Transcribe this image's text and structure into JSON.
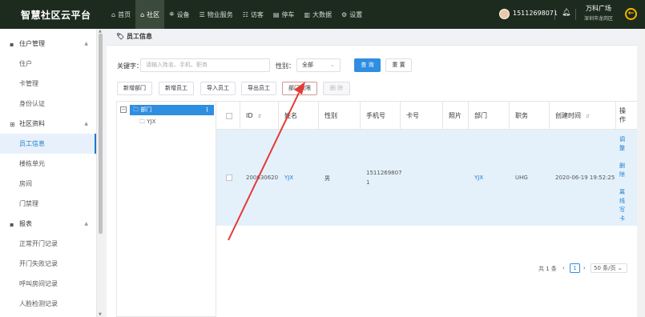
{
  "app": {
    "title": "智慧社区云平台"
  },
  "topnav": [
    {
      "icon": "⌂",
      "label": "首页"
    },
    {
      "icon": "⌂",
      "label": "社区"
    },
    {
      "icon": "⛯",
      "label": "设备"
    },
    {
      "icon": "☰",
      "label": "物业服务"
    },
    {
      "icon": "☷",
      "label": "访客"
    },
    {
      "icon": "▤",
      "label": "停车"
    },
    {
      "icon": "▥",
      "label": "大数据"
    },
    {
      "icon": "⚙",
      "label": "设置"
    }
  ],
  "user": {
    "phone": "15112698071",
    "site_name": "万科广场",
    "site_area": "深圳市龙岗区"
  },
  "sidebar": {
    "groups": [
      {
        "label": "住户管理",
        "items": [
          "住户",
          "卡管理",
          "身份认证"
        ]
      },
      {
        "label": "社区资料",
        "items": [
          "员工信息",
          "楼栋单元",
          "房间",
          "门禁理"
        ]
      },
      {
        "label": "报表",
        "items": [
          "正常开门记录",
          "开门失败记录",
          "呼叫房间记录",
          "人脸检测记录"
        ]
      }
    ]
  },
  "breadcrumb": "员工信息",
  "filters": {
    "keyword_label": "关键字：",
    "keyword_placeholder": "请输入姓名、手机、职务",
    "gender_label": "性别：",
    "gender_value": "全部",
    "search_label": "查 询",
    "reset_label": "重 置"
  },
  "toolbar": {
    "add_dept": "新增部门",
    "add_staff": "新增员工",
    "import_staff": "导入员工",
    "export_staff": "导出员工",
    "dept_auth": "部门权限",
    "delete": "删 除"
  },
  "tree": {
    "root": "部门",
    "child": "YJX",
    "menu": "⋮"
  },
  "table": {
    "headers": [
      "ID",
      "姓名",
      "性别",
      "手机号",
      "卡号",
      "照片",
      "部门",
      "职务",
      "创建时间",
      "操作"
    ],
    "row": {
      "id": "200630620",
      "name": "YJX",
      "gender": "男",
      "phone_line1": "1511269807",
      "phone_line2": "1",
      "card": "",
      "photo": "",
      "dept": "YJX",
      "title": "UHG",
      "created": "2020-06-19 19:52:25",
      "actions": [
        "调整",
        "删除",
        "离线写卡"
      ]
    }
  },
  "pager": {
    "total": "共 1 条",
    "page": "1",
    "size": "50 条/页"
  },
  "colors": {
    "topbar": "#1d2b1e",
    "primary": "#2f8ee0",
    "annotation": "#e53935"
  }
}
